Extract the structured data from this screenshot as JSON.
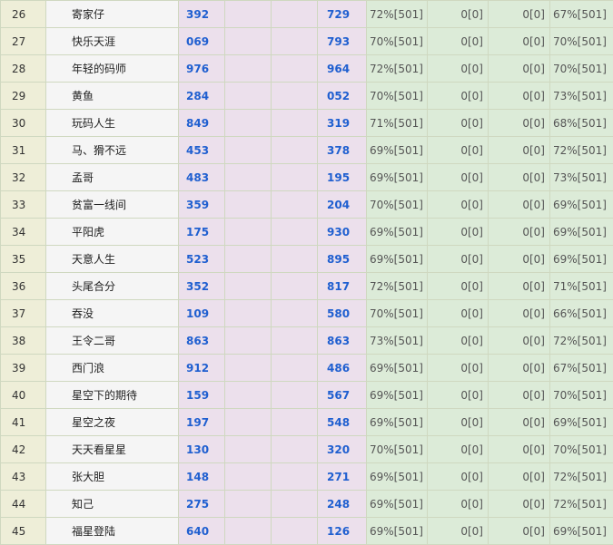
{
  "rows": [
    {
      "rank": "26",
      "name": "寄家仔",
      "v1": "392",
      "v2": "729",
      "p1": "72%[501]",
      "z1": "0[0]",
      "z2": "0[0]",
      "p2": "67%[501]"
    },
    {
      "rank": "27",
      "name": "快乐天涯",
      "v1": "069",
      "v2": "793",
      "p1": "70%[501]",
      "z1": "0[0]",
      "z2": "0[0]",
      "p2": "70%[501]"
    },
    {
      "rank": "28",
      "name": "年轻的码师",
      "v1": "976",
      "v2": "964",
      "p1": "72%[501]",
      "z1": "0[0]",
      "z2": "0[0]",
      "p2": "70%[501]"
    },
    {
      "rank": "29",
      "name": "黄鱼",
      "v1": "284",
      "v2": "052",
      "p1": "70%[501]",
      "z1": "0[0]",
      "z2": "0[0]",
      "p2": "73%[501]"
    },
    {
      "rank": "30",
      "name": "玩码人生",
      "v1": "849",
      "v2": "319",
      "p1": "71%[501]",
      "z1": "0[0]",
      "z2": "0[0]",
      "p2": "68%[501]"
    },
    {
      "rank": "31",
      "name": "马、猾不远",
      "v1": "453",
      "v2": "378",
      "p1": "69%[501]",
      "z1": "0[0]",
      "z2": "0[0]",
      "p2": "72%[501]"
    },
    {
      "rank": "32",
      "name": "孟哥",
      "v1": "483",
      "v2": "195",
      "p1": "69%[501]",
      "z1": "0[0]",
      "z2": "0[0]",
      "p2": "73%[501]"
    },
    {
      "rank": "33",
      "name": "贫富一线间",
      "v1": "359",
      "v2": "204",
      "p1": "70%[501]",
      "z1": "0[0]",
      "z2": "0[0]",
      "p2": "69%[501]"
    },
    {
      "rank": "34",
      "name": "平阳虎",
      "v1": "175",
      "v2": "930",
      "p1": "69%[501]",
      "z1": "0[0]",
      "z2": "0[0]",
      "p2": "69%[501]"
    },
    {
      "rank": "35",
      "name": "天意人生",
      "v1": "523",
      "v2": "895",
      "p1": "69%[501]",
      "z1": "0[0]",
      "z2": "0[0]",
      "p2": "69%[501]"
    },
    {
      "rank": "36",
      "name": "头尾合分",
      "v1": "352",
      "v2": "817",
      "p1": "72%[501]",
      "z1": "0[0]",
      "z2": "0[0]",
      "p2": "71%[501]"
    },
    {
      "rank": "37",
      "name": "吞没",
      "v1": "109",
      "v2": "580",
      "p1": "70%[501]",
      "z1": "0[0]",
      "z2": "0[0]",
      "p2": "66%[501]"
    },
    {
      "rank": "38",
      "name": "王令二哥",
      "v1": "863",
      "v2": "863",
      "p1": "73%[501]",
      "z1": "0[0]",
      "z2": "0[0]",
      "p2": "72%[501]"
    },
    {
      "rank": "39",
      "name": "西门浪",
      "v1": "912",
      "v2": "486",
      "p1": "69%[501]",
      "z1": "0[0]",
      "z2": "0[0]",
      "p2": "67%[501]"
    },
    {
      "rank": "40",
      "name": "星空下的期待",
      "v1": "159",
      "v2": "567",
      "p1": "69%[501]",
      "z1": "0[0]",
      "z2": "0[0]",
      "p2": "70%[501]"
    },
    {
      "rank": "41",
      "name": "星空之夜",
      "v1": "197",
      "v2": "548",
      "p1": "69%[501]",
      "z1": "0[0]",
      "z2": "0[0]",
      "p2": "69%[501]"
    },
    {
      "rank": "42",
      "name": "天天看星星",
      "v1": "130",
      "v2": "320",
      "p1": "70%[501]",
      "z1": "0[0]",
      "z2": "0[0]",
      "p2": "70%[501]"
    },
    {
      "rank": "43",
      "name": "张大胆",
      "v1": "148",
      "v2": "271",
      "p1": "69%[501]",
      "z1": "0[0]",
      "z2": "0[0]",
      "p2": "72%[501]"
    },
    {
      "rank": "44",
      "name": "知己",
      "v1": "275",
      "v2": "248",
      "p1": "69%[501]",
      "z1": "0[0]",
      "z2": "0[0]",
      "p2": "72%[501]"
    },
    {
      "rank": "45",
      "name": "福星登陆",
      "v1": "640",
      "v2": "126",
      "p1": "69%[501]",
      "z1": "0[0]",
      "z2": "0[0]",
      "p2": "69%[501]"
    }
  ]
}
